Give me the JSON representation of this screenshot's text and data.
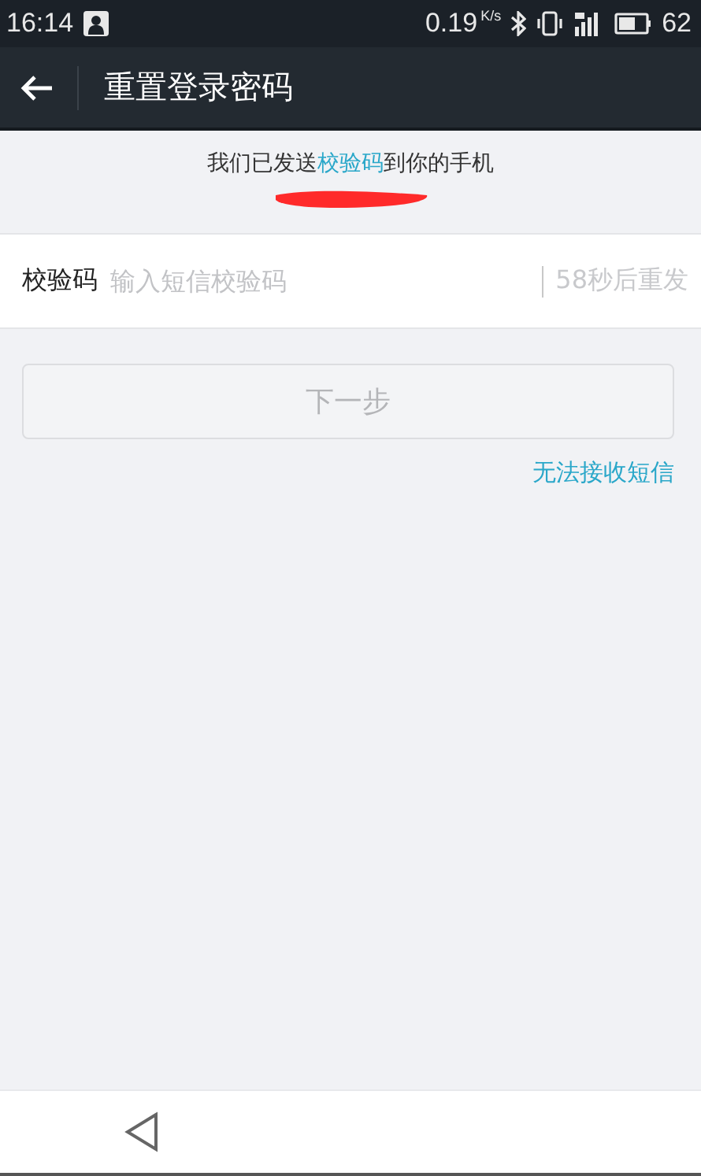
{
  "status_bar": {
    "time": "16:14",
    "net_speed": "0.19",
    "net_unit": "K/s",
    "battery": "62"
  },
  "app_bar": {
    "title": "重置登录密码"
  },
  "message": "我们已发送**校验码**到你的手机",
  "code_field": {
    "label": "校验码",
    "placeholder": "输入短信校验码",
    "resend": "58秒后重发"
  },
  "next_button": {
    "label": "下一步",
    "disabled": true
  },
  "help_link": "无法接收短信"
}
